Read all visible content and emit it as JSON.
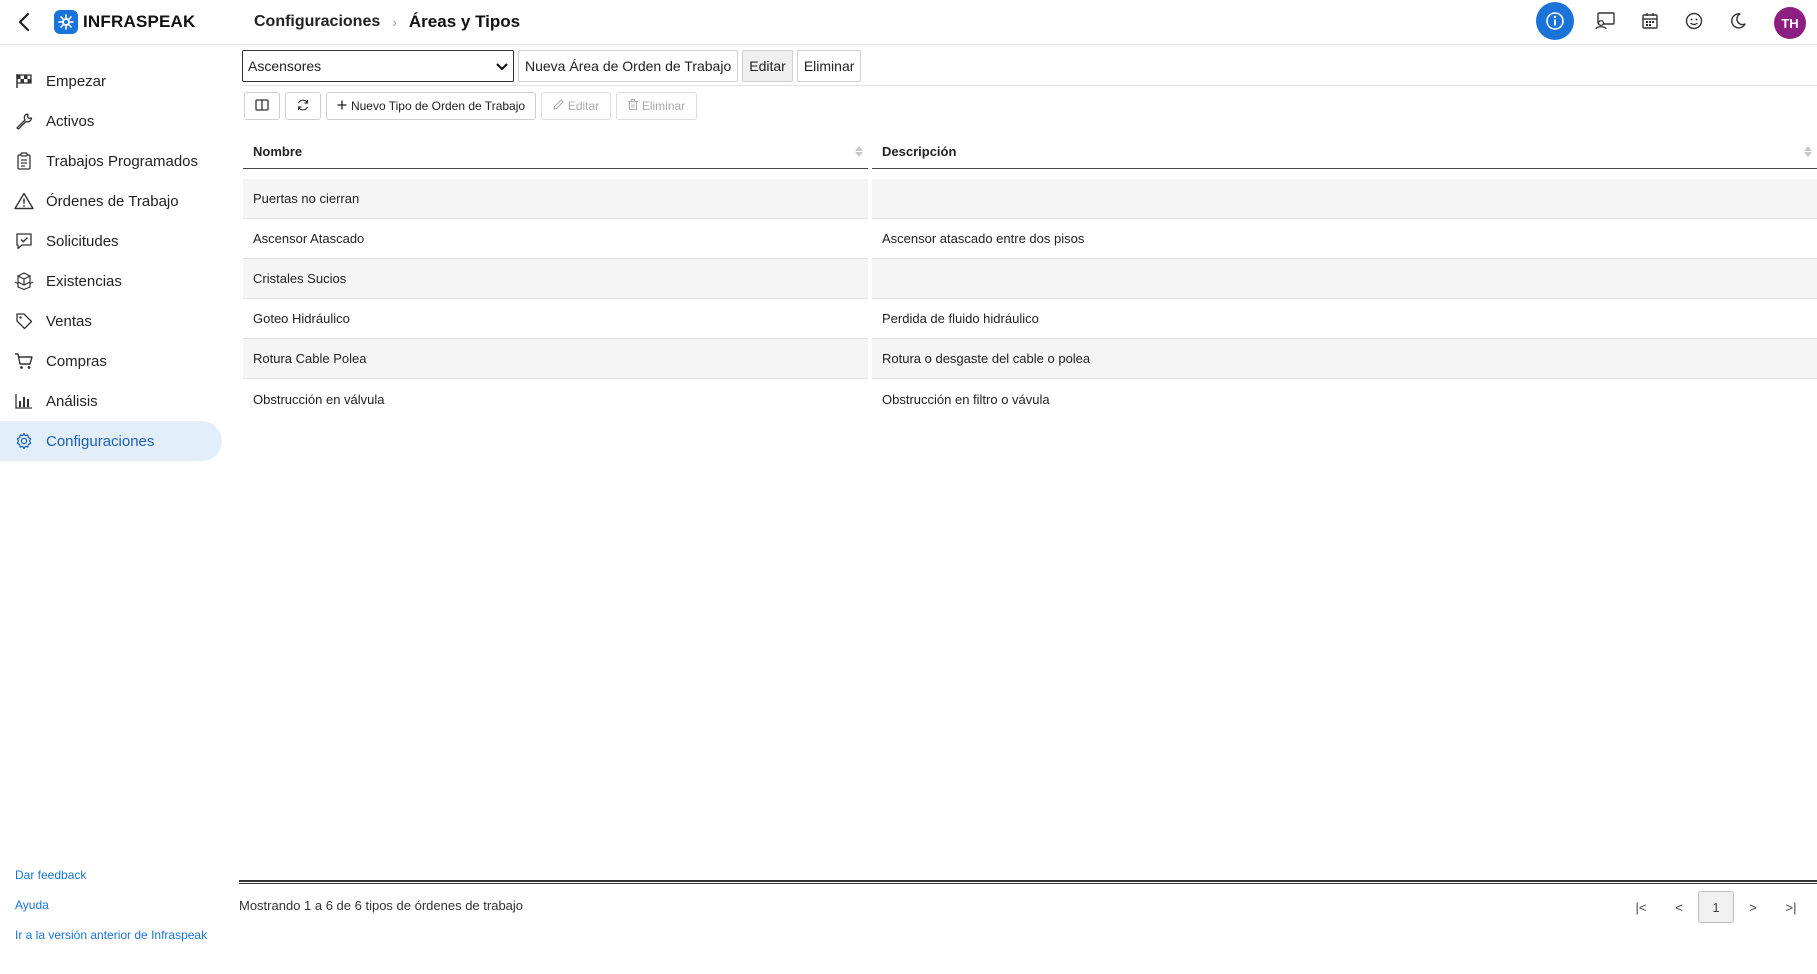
{
  "header": {
    "logo_text": "INFRASPEAK",
    "breadcrumb_parent": "Configuraciones",
    "breadcrumb_current": "Áreas y Tipos",
    "avatar_initials": "TH"
  },
  "sidebar": {
    "items": [
      {
        "label": "Empezar",
        "icon": "flag-icon"
      },
      {
        "label": "Activos",
        "icon": "wrench-icon"
      },
      {
        "label": "Trabajos Programados",
        "icon": "clipboard-icon"
      },
      {
        "label": "Órdenes de Trabajo",
        "icon": "warning-icon"
      },
      {
        "label": "Solicitudes",
        "icon": "request-icon"
      },
      {
        "label": "Existencias",
        "icon": "boxes-icon"
      },
      {
        "label": "Ventas",
        "icon": "tag-icon"
      },
      {
        "label": "Compras",
        "icon": "cart-icon"
      },
      {
        "label": "Análisis",
        "icon": "bar-chart-icon"
      },
      {
        "label": "Configuraciones",
        "icon": "gear-icon"
      }
    ],
    "active": "Configuraciones",
    "links": {
      "feedback": "Dar feedback",
      "help": "Ayuda",
      "old_version": "Ir a la versión anterior de Infraspeak"
    }
  },
  "area_bar": {
    "selected_area": "Ascensores",
    "new_area_label": "Nueva Área de Orden de Trabajo",
    "edit_label": "Editar",
    "delete_label": "Eliminar"
  },
  "toolbar": {
    "new_type_label": "Nuevo Tipo de Orden de Trabajo",
    "edit_label": "Editar",
    "delete_label": "Eliminar"
  },
  "table": {
    "columns": [
      "Nombre",
      "Descripción"
    ],
    "rows": [
      {
        "name": "Puertas no cierran",
        "description": ""
      },
      {
        "name": "Ascensor Atascado",
        "description": "Ascensor atascado entre dos pisos"
      },
      {
        "name": "Cristales Sucios",
        "description": ""
      },
      {
        "name": "Goteo Hidráulico",
        "description": "Perdida de fluido hidráulico"
      },
      {
        "name": "Rotura Cable Polea",
        "description": "Rotura o desgaste del cable o polea"
      },
      {
        "name": "Obstrucción en válvula",
        "description": "Obstrucción en filtro o vávula"
      }
    ]
  },
  "footer": {
    "info": "Mostrando 1 a 6 de 6 tipos de órdenes de trabajo",
    "pager": {
      "first": "|<",
      "prev": "<",
      "current": "1",
      "next": ">",
      "last": ">|"
    }
  },
  "colors": {
    "accent": "#1a73d9",
    "active_nav_bg": "#e3eefb",
    "avatar_bg": "#8d1f82"
  }
}
